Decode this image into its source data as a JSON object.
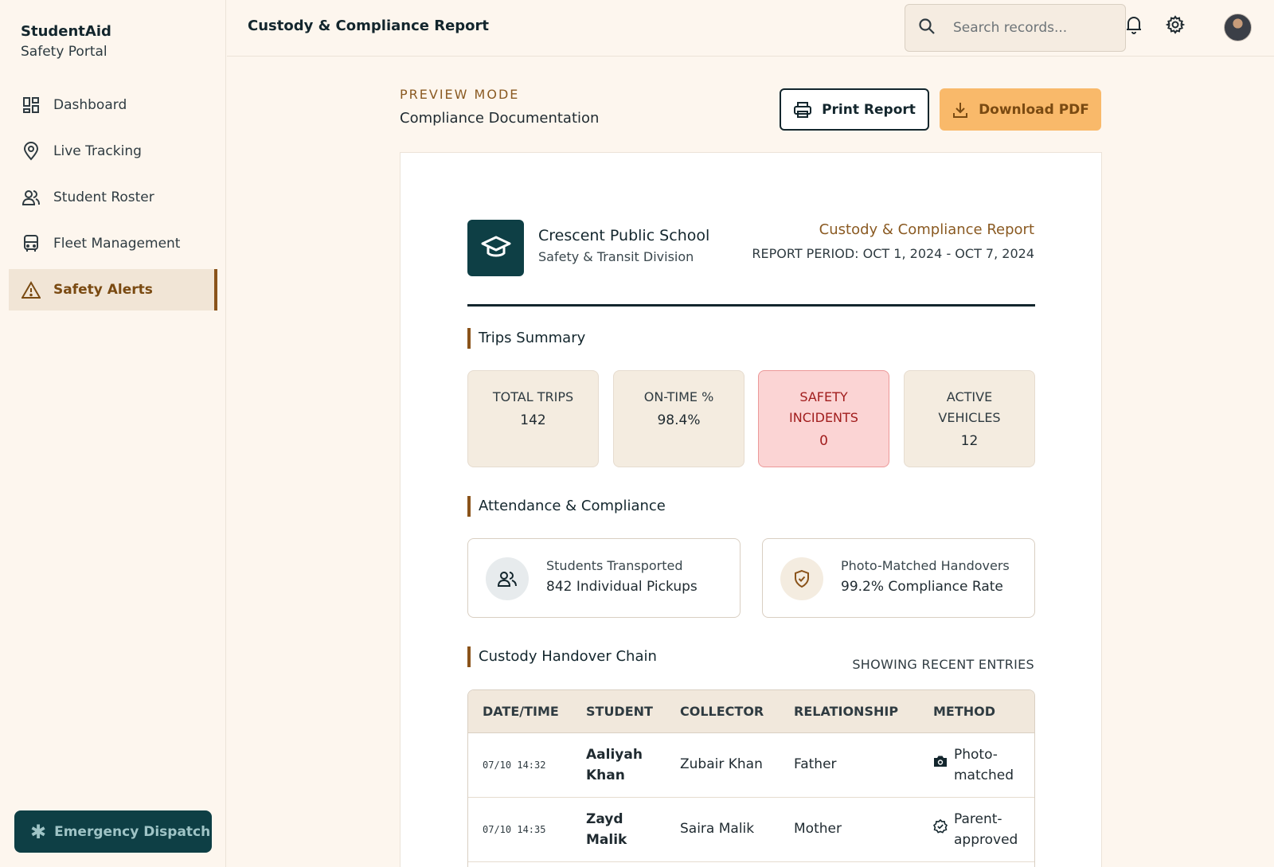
{
  "app": {
    "name": "StudentAid",
    "subtitle": "Safety Portal"
  },
  "sidebar": {
    "items": [
      {
        "label": "Dashboard",
        "icon": "dashboard-icon"
      },
      {
        "label": "Live Tracking",
        "icon": "location-pin-icon"
      },
      {
        "label": "Student Roster",
        "icon": "people-icon"
      },
      {
        "label": "Fleet Management",
        "icon": "bus-icon"
      },
      {
        "label": "Safety Alerts",
        "icon": "warning-icon",
        "active": true
      }
    ],
    "emergency_label": "Emergency Dispatch"
  },
  "header": {
    "title": "Custody & Compliance Report",
    "search_placeholder": "Search records..."
  },
  "main": {
    "preview_label": "PREVIEW MODE",
    "preview_sub": "Compliance Documentation",
    "print_label": "Print Report",
    "download_label": "Download PDF"
  },
  "report": {
    "school_name": "Crescent Public School",
    "division": "Safety & Transit Division",
    "title": "Custody & Compliance Report",
    "period": "REPORT PERIOD: OCT 1, 2024 - OCT 7, 2024",
    "trips_heading": "Trips Summary",
    "stats": [
      {
        "label": "TOTAL TRIPS",
        "value": "142"
      },
      {
        "label": "ON-TIME %",
        "value": "98.4%"
      },
      {
        "label": "SAFETY INCIDENTS",
        "value": "0"
      },
      {
        "label": "ACTIVE VEHICLES",
        "value": "12"
      }
    ],
    "attendance_heading": "Attendance & Compliance",
    "attendance": [
      {
        "title": "Students Transported",
        "value": "842 Individual Pickups"
      },
      {
        "title": "Photo-Matched Handovers",
        "value": "99.2% Compliance Rate"
      }
    ],
    "chain_heading": "Custody Handover Chain",
    "chain_note": "SHOWING RECENT ENTRIES",
    "columns": [
      "DATE/TIME",
      "STUDENT",
      "COLLECTOR",
      "RELATIONSHIP",
      "METHOD"
    ],
    "rows": [
      {
        "time": "07/10 14:32",
        "student": "Aaliyah Khan",
        "collector": "Zubair Khan",
        "relationship": "Father",
        "method": "Photo-matched"
      },
      {
        "time": "07/10 14:35",
        "student": "Zayd Malik",
        "collector": "Saira Malik",
        "relationship": "Mother",
        "method": "Parent-approved"
      }
    ]
  },
  "colors": {
    "accent": "#8a531a",
    "brand_dark": "#0e3f45",
    "download_bg": "#f9b96a",
    "incident_bg": "#fbd4d4"
  }
}
